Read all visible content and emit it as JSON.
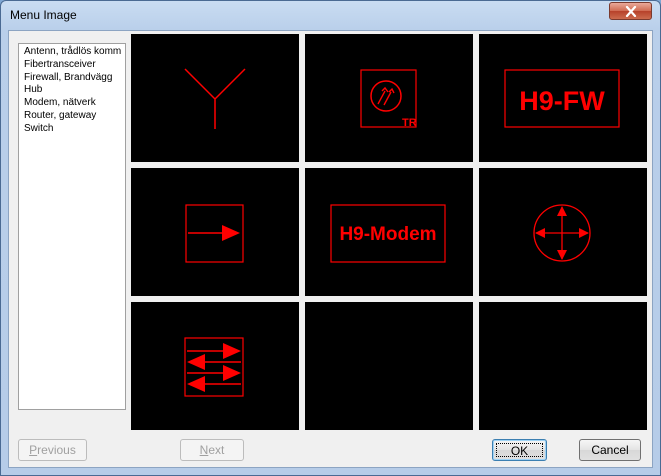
{
  "window": {
    "title": "Menu Image"
  },
  "list": {
    "items": [
      "Antenn, trådlös komm",
      "Fibertransceiver",
      "Firewall, Brandvägg",
      "Hub",
      "Modem, nätverk",
      "Router, gateway",
      "Switch"
    ]
  },
  "tiles": [
    {
      "icon": "antenna-symbol-icon"
    },
    {
      "icon": "fiber-transceiver-symbol-icon",
      "label": "TR"
    },
    {
      "icon": "firewall-symbol-icon",
      "label": "H9-FW"
    },
    {
      "icon": "hub-symbol-icon"
    },
    {
      "icon": "modem-symbol-icon",
      "label": "H9-Modem"
    },
    {
      "icon": "router-symbol-icon"
    },
    {
      "icon": "switch-symbol-icon"
    },
    {
      "icon": "empty-tile"
    },
    {
      "icon": "empty-tile"
    }
  ],
  "buttons": {
    "previous_first": "P",
    "previous_rest": "revious",
    "next_first": "N",
    "next_rest": "ext",
    "ok": "OK",
    "cancel": "Cancel"
  },
  "colors": {
    "symbol": "#ff0000",
    "tile_bg": "#000000"
  }
}
